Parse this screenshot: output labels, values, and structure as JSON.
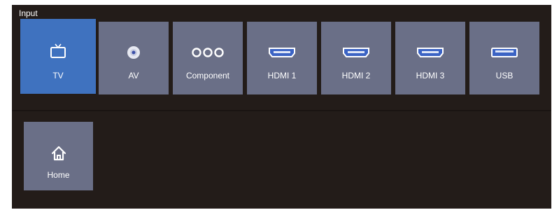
{
  "panel": {
    "title": "Input"
  },
  "inputs": [
    {
      "label": "TV",
      "icon": "tv-icon",
      "selected": true
    },
    {
      "label": "AV",
      "icon": "av-disc-icon",
      "selected": false
    },
    {
      "label": "Component",
      "icon": "component-icon",
      "selected": false
    },
    {
      "label": "HDMI 1",
      "icon": "hdmi-port-icon",
      "selected": false
    },
    {
      "label": "HDMI 2",
      "icon": "hdmi-port-icon",
      "selected": false
    },
    {
      "label": "HDMI 3",
      "icon": "hdmi-port-icon",
      "selected": false
    },
    {
      "label": "USB",
      "icon": "usb-port-icon",
      "selected": false
    }
  ],
  "home": {
    "label": "Home",
    "icon": "home-icon"
  },
  "colors": {
    "background": "#231c19",
    "tile": "#6a6f87",
    "selected_tile": "#3f72bf"
  }
}
